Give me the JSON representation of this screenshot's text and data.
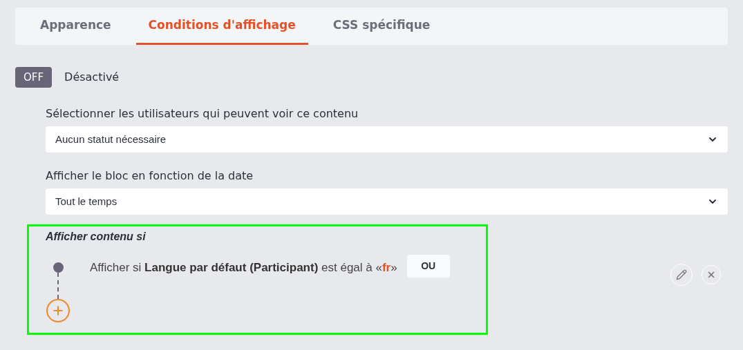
{
  "tabs": [
    {
      "label": "Apparence",
      "selected": false
    },
    {
      "label": "Conditions d'affichage",
      "selected": true
    },
    {
      "label": "CSS spécifique",
      "selected": false
    }
  ],
  "toggle": {
    "label": "OFF",
    "on": false,
    "status": "Désactivé"
  },
  "selects": [
    {
      "label": "Sélectionner les utilisateurs qui peuvent voir ce contenu",
      "value": "Aucun statut nécessaire"
    },
    {
      "label": "Afficher le bloc en fonction de la date",
      "value": "Tout le temps"
    }
  ],
  "conditions": {
    "title": "Afficher contenu si",
    "rules": [
      {
        "text_before": "Afficher si",
        "field": "Langue par défaut (Participant)",
        "text_middle": "est égal à «",
        "value": "fr",
        "text_after": "»",
        "operator": "OU"
      }
    ]
  }
}
